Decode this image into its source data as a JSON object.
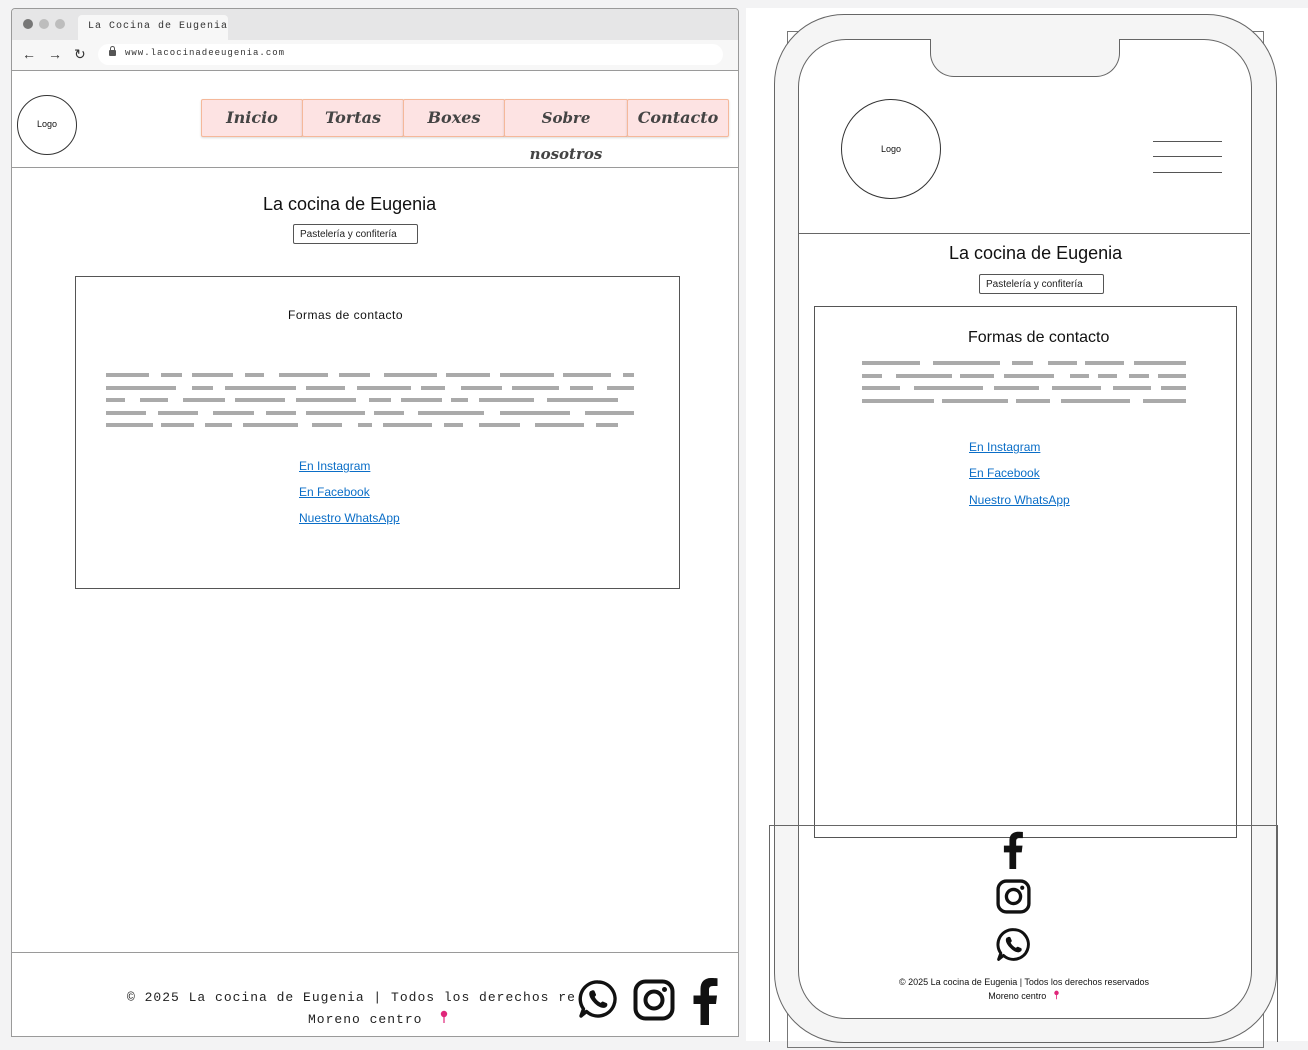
{
  "colors": {
    "menu_bg": "#fde3e3",
    "menu_border": "#f5b89a",
    "link": "#0b6ec7",
    "placeholder_text": "#aaaaaa"
  },
  "browser": {
    "tab_title": "La Cocina de Eugenia",
    "url": "www.lacocinadeeugenia.com"
  },
  "desktop": {
    "logo": "Logo",
    "nav": [
      "Inicio",
      "Tortas",
      "Boxes",
      "Sobre nosotros",
      "Contacto"
    ],
    "title": "La cocina de Eugenia",
    "subtitle": "Pastelería y confitería",
    "contact": {
      "heading": "Formas de contacto",
      "links": [
        "En Instagram",
        "En Facebook",
        "Nuestro WhatsApp"
      ]
    },
    "footer": {
      "line1": "© 2025 La cocina de Eugenia | Todos los derechos re",
      "line2": "Moreno centro",
      "pin_icon": "location-pin-icon"
    }
  },
  "mobile": {
    "logo": "Logo",
    "menu_icon": "hamburger-icon",
    "title": "La cocina de Eugenia",
    "subtitle": "Pastelería y confitería",
    "contact": {
      "heading": "Formas de contacto",
      "links": [
        "En Instagram",
        "En Facebook",
        "Nuestro WhatsApp"
      ]
    },
    "footer": {
      "line1": "© 2025 La cocina de Eugenia | Todos los derechos reservados",
      "line2": "Moreno centro",
      "pin_icon": "location-pin-icon"
    }
  }
}
